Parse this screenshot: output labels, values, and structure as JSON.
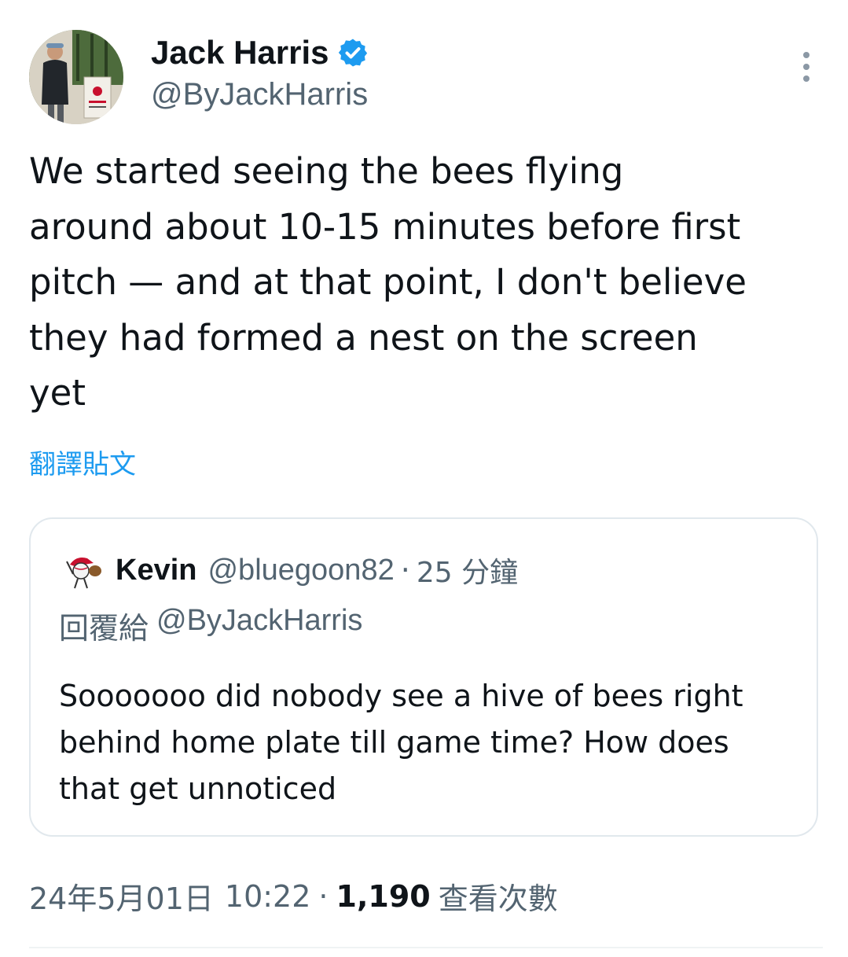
{
  "author": {
    "display_name": "Jack Harris",
    "handle": "@ByJackHarris",
    "verified_icon": "verified-badge-icon",
    "avatar_icon": "profile-photo"
  },
  "tweet": {
    "text": "We started seeing the bees flying\naround about 10-15 minutes before first\npitch — and at that point, I don't believe\nthey had formed a nest on the screen\nyet",
    "translate_label": "翻譯貼文"
  },
  "quoted_tweet": {
    "display_name": "Kevin",
    "handle": "@bluegoon82",
    "separator": "·",
    "time_ago": "25 分鐘",
    "reply_prefix": "回覆給",
    "reply_to": "@ByJackHarris",
    "text": "Sooooooo did nobody see a hive of bees right\nbehind home plate till game time? How does\nthat get unnoticed"
  },
  "meta": {
    "date": "24年5月01日",
    "time": "10:22",
    "separator": "·",
    "views_count": "1,190",
    "views_label": "查看次數"
  },
  "colors": {
    "accent": "#1d9bf0",
    "secondary_text": "#536471",
    "primary_text": "#0f1419",
    "border": "#e1e8ed"
  }
}
